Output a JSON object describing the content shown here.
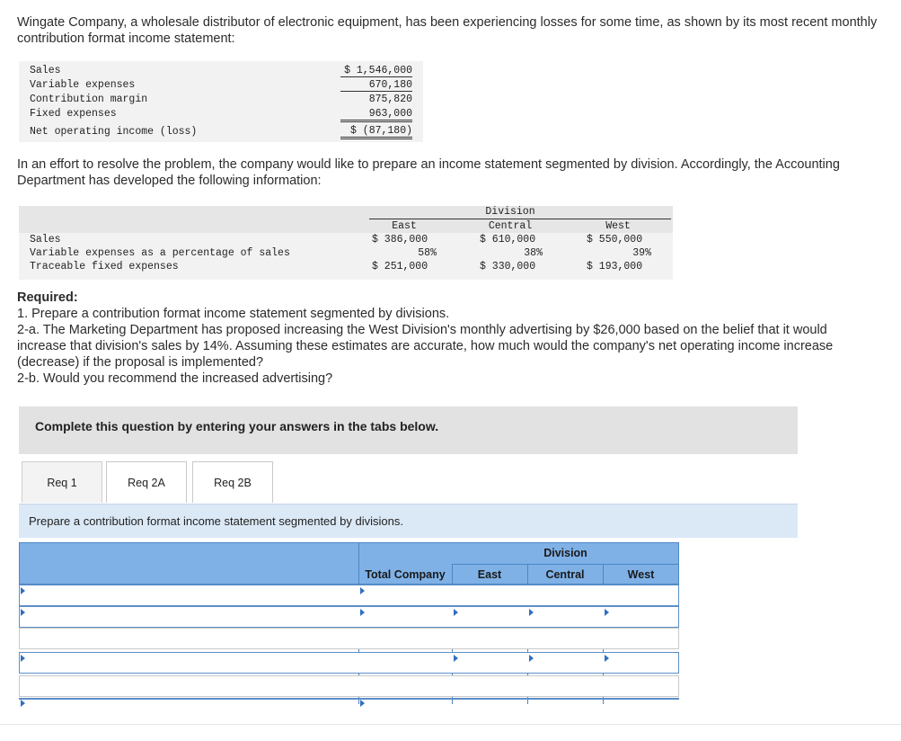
{
  "intro": "Wingate Company, a wholesale distributor of electronic equipment, has been experiencing losses for some time, as shown by its most recent monthly contribution format income statement:",
  "statement": {
    "rows": [
      {
        "label": "Sales",
        "value": "$ 1,546,000"
      },
      {
        "label": "Variable expenses",
        "value": "670,180"
      },
      {
        "label": "Contribution margin",
        "value": "875,820"
      },
      {
        "label": "Fixed expenses",
        "value": "963,000"
      },
      {
        "label": "Net operating income (loss)",
        "value": "$ (87,180)"
      }
    ]
  },
  "intro2": "In an effort to resolve the problem, the company would like to prepare an income statement segmented by division. Accordingly, the Accounting Department has developed the following information:",
  "division_info": {
    "group_header": "Division",
    "columns": [
      "East",
      "Central",
      "West"
    ],
    "rows": [
      {
        "label": "Sales",
        "values": [
          "$ 386,000",
          "$ 610,000",
          "$ 550,000"
        ]
      },
      {
        "label": "Variable expenses as a percentage of sales",
        "values": [
          "58%",
          "38%",
          "39%"
        ]
      },
      {
        "label": "Traceable fixed expenses",
        "values": [
          "$ 251,000",
          "$ 330,000",
          "$ 193,000"
        ]
      }
    ]
  },
  "required": {
    "heading": "Required:",
    "items": [
      "1. Prepare a contribution format income statement segmented by divisions.",
      "2-a. The Marketing Department has proposed increasing the West Division's monthly advertising by $26,000 based on the belief that it would increase that division's sales by 14%. Assuming these estimates are accurate, how much would the company's net operating income increase (decrease) if the proposal is implemented?",
      "2-b. Would you recommend the increased advertising?"
    ]
  },
  "banner": "Complete this question by entering your answers in the tabs below.",
  "tabs": [
    "Req 1",
    "Req 2A",
    "Req 2B"
  ],
  "active_tab": "Req 1",
  "prompt": "Prepare a contribution format income statement segmented by divisions.",
  "answer_table": {
    "group_header": "Division",
    "columns": [
      "Total Company",
      "East",
      "Central",
      "West"
    ]
  },
  "colors": {
    "header_blue": "#7fb1e6",
    "prompt_bg": "#dbe9f7",
    "banner_bg": "#e2e2e2",
    "info_bg": "#f2f2f2"
  }
}
